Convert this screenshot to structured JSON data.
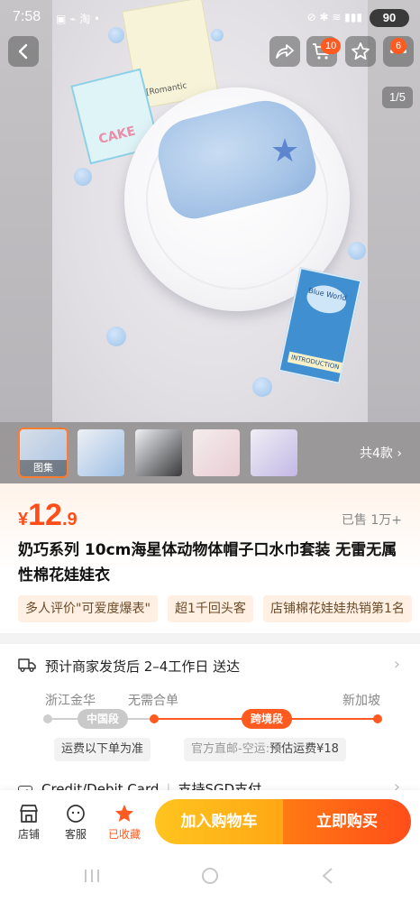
{
  "status_bar": {
    "time": "7:58",
    "app_icons": "▣ ⌁ 淘 •",
    "system_icons": "⊘ ✱ ≋ ▮▮▮",
    "battery": "90"
  },
  "nav": {
    "back_icon": "chevron-left-icon",
    "share_icon": "share-icon",
    "cart_icon": "cart-icon",
    "cart_badge": "10",
    "favorite_icon": "star-icon",
    "more_icon": "more-icon",
    "more_badge": "6"
  },
  "gallery": {
    "counter": "1/5",
    "thumb_active_label": "图集",
    "total_variants": "共4款",
    "total_chevron": "›",
    "photo_texts": {
      "card_cake": "CAKE",
      "card_romantic": "[Romantic",
      "card_blue_world": "Blue World",
      "card_intro": "INTRODUCTION"
    }
  },
  "product": {
    "currency": "¥",
    "price_int": "12",
    "price_dec": ".9",
    "sold": "已售 1万+",
    "title": "奶巧系列 10cm海星体动物体帽子口水巾套装 无雷无属性棉花娃娃衣",
    "tags": [
      "多人评价\"可爱度爆表\"",
      "超1千回头客",
      "店铺棉花娃娃热销第1名"
    ]
  },
  "shipping": {
    "estimate": "预计商家发货后 2–4工作日 送达",
    "chevron": "›",
    "origin": "浙江金华",
    "middle": "无需合单",
    "destination": "新加坡",
    "segment_domestic": "中国段",
    "segment_cross": "跨境段",
    "note_domestic": "运费以下单为准",
    "note_cross_label": "官方直邮-空运:",
    "note_cross_value": "预估运费¥18",
    "payment_method": "Credit/Debit Card",
    "payment_support": "支持SGD支付",
    "payment_chevron": "›"
  },
  "bottom_bar": {
    "store_label": "店铺",
    "service_label": "客服",
    "favorited_label": "已收藏",
    "add_to_cart": "加入购物车",
    "buy_now": "立即购买"
  },
  "colors": {
    "accent": "#ff4e1a",
    "cart_button": "#ffb01a",
    "buy_button": "#ff5a1a"
  }
}
